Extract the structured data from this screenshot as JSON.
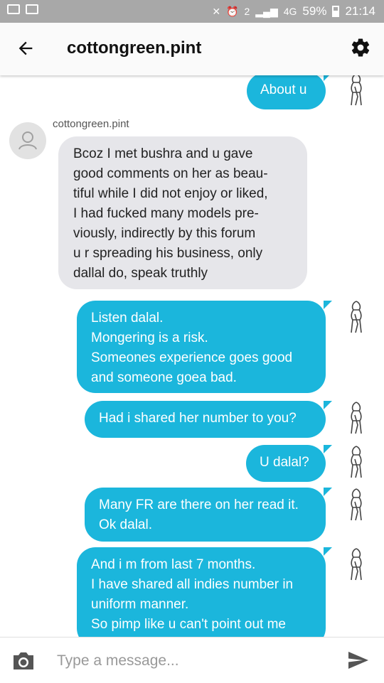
{
  "status_bar": {
    "battery_percent": "59%",
    "time": "21:14",
    "network": "4G",
    "notification_count": "2"
  },
  "header": {
    "title": "cottongreen.pint",
    "back_icon": "arrow-left-icon",
    "settings_icon": "gear-icon"
  },
  "conversation": {
    "contact_name": "cottongreen.pint",
    "messages": [
      {
        "direction": "outgoing",
        "lines": [
          "About u"
        ]
      },
      {
        "direction": "incoming",
        "lines": [
          "Bcoz I met bushra and u gave",
          "good comments on her as beau-",
          "tiful while I did not enjoy or liked,",
          "I had fucked many models pre-",
          "viously, indirectly by this forum",
          "u r spreading his business, only",
          "dallal do, speak truthly"
        ]
      },
      {
        "direction": "outgoing",
        "lines": [
          "Listen dalal.",
          "Mongering is a risk.",
          "Someones experience goes good",
          "and someone goea bad."
        ]
      },
      {
        "direction": "outgoing",
        "lines": [
          "Had i shared her number to you?"
        ]
      },
      {
        "direction": "outgoing",
        "lines": [
          "U dalal?"
        ]
      },
      {
        "direction": "outgoing",
        "lines": [
          "Many FR are there on her read it.",
          "Ok dalal."
        ]
      },
      {
        "direction": "outgoing",
        "lines": [
          "And i m from last 7 months.",
          "I have shared all indies number in",
          "uniform manner.",
          "So pimp like u can't point out me"
        ]
      }
    ]
  },
  "composer": {
    "placeholder": "Type a message...",
    "camera_icon": "camera-icon",
    "send_icon": "send-icon"
  },
  "colors": {
    "outgoing_bubble": "#1bb6dc",
    "incoming_bubble": "#e6e6ea",
    "status_bar": "#a8a8a8"
  }
}
